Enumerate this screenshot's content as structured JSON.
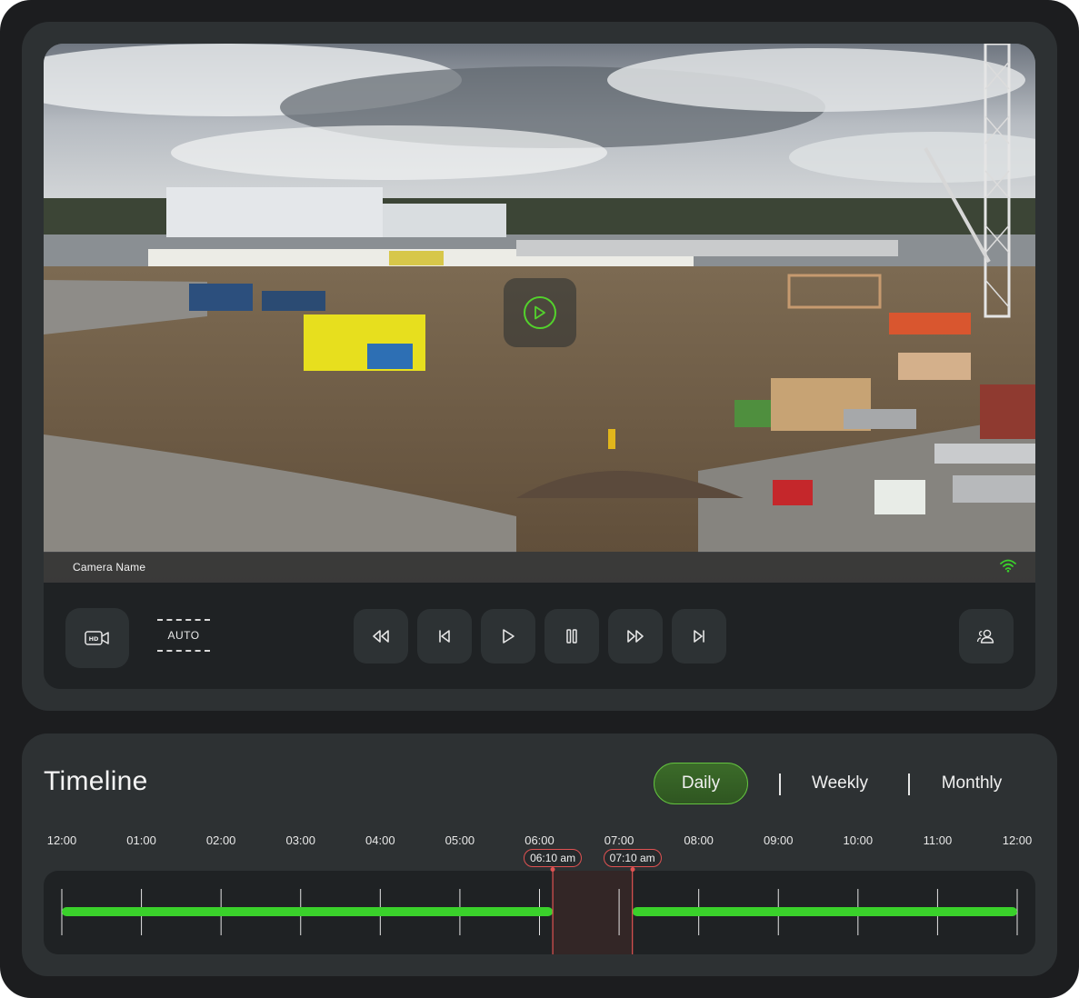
{
  "player": {
    "camera_name": "Camera Name",
    "quality_icon": "hd-camera-icon",
    "quality_mode": "AUTO",
    "signal_icon": "wifi-icon",
    "center_play_icon": "play-circle-icon",
    "buttons": [
      {
        "name": "rewind-button",
        "icon": "rewind-icon"
      },
      {
        "name": "previous-button",
        "icon": "skip-back-icon"
      },
      {
        "name": "play-button",
        "icon": "play-icon"
      },
      {
        "name": "pause-button",
        "icon": "pause-icon"
      },
      {
        "name": "fast-forward-button",
        "icon": "fast-forward-icon"
      },
      {
        "name": "next-button",
        "icon": "skip-forward-icon"
      }
    ],
    "users_icon": "users-icon"
  },
  "timeline": {
    "title": "Timeline",
    "tabs": [
      {
        "label": "Daily",
        "active": true
      },
      {
        "label": "Weekly",
        "active": false
      },
      {
        "label": "Monthly",
        "active": false
      }
    ],
    "hours": [
      "12:00",
      "01:00",
      "02:00",
      "03:00",
      "04:00",
      "05:00",
      "06:00",
      "07:00",
      "08:00",
      "09:00",
      "10:00",
      "11:00",
      "12:00"
    ],
    "selection": {
      "start_label": "06:10 am",
      "end_label": "07:10 am",
      "start_hours": 6.1667,
      "end_hours": 7.1667
    },
    "recorded_segments": [
      [
        0,
        6.1667
      ],
      [
        7.1667,
        12
      ]
    ],
    "colors": {
      "recorded": "#3ad12b",
      "selection_edge": "#e05252",
      "accent": "#63c23f"
    }
  }
}
